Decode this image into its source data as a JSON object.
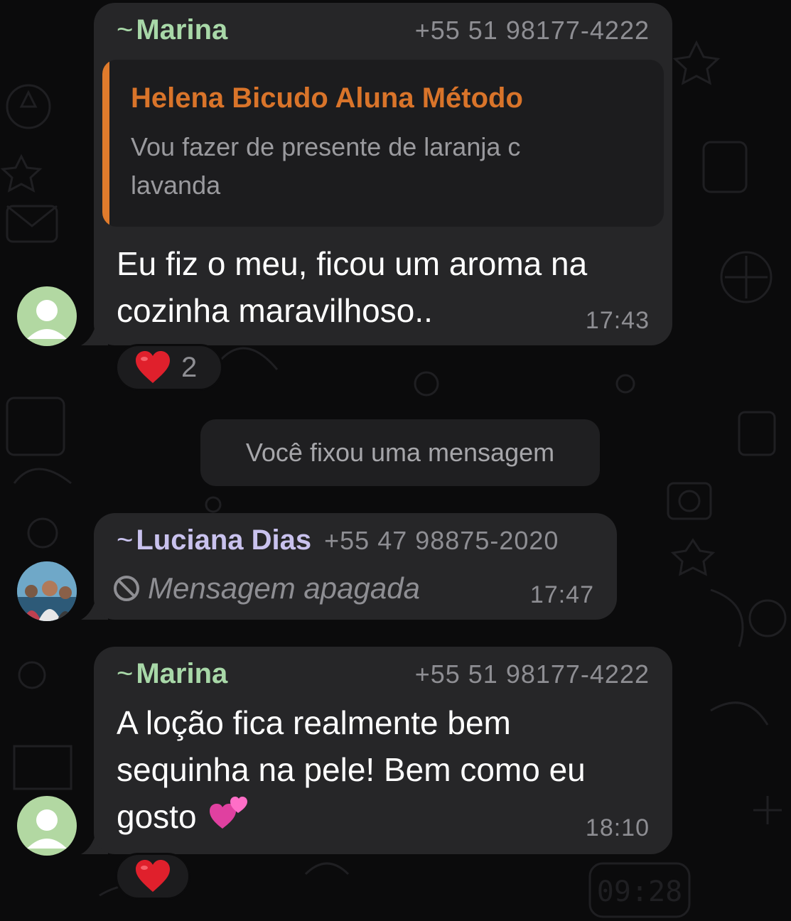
{
  "messages": [
    {
      "sender_prefix": "~",
      "sender": "Marina",
      "sender_color": "#a8d8a8",
      "phone": "+55 51 98177-4222",
      "quoted": {
        "author": "Helena Bicudo Aluna Método",
        "author_color": "#d9742a",
        "text": "Vou fazer de presente de laranja c lavanda"
      },
      "text_lines": [
        "Eu fiz o meu, ficou um aroma na",
        "cozinha maravilhoso.."
      ],
      "time": "17:43",
      "reaction": {
        "emoji": "heart",
        "count": "2"
      }
    },
    {
      "sender_prefix": "~",
      "sender": "Luciana Dias",
      "sender_color": "#c9c2ee",
      "phone": "+55 47 98875-2020",
      "deleted_text": "Mensagem apagada",
      "time": "17:47"
    },
    {
      "sender_prefix": "~",
      "sender": "Marina",
      "sender_color": "#a8d8a8",
      "phone": "+55 51 98177-4222",
      "text_lines": [
        "A loção fica realmente bem",
        "sequinha na pele! Bem como eu",
        "gosto"
      ],
      "emoji": "two-hearts",
      "time": "18:10",
      "reaction": {
        "emoji": "heart"
      }
    }
  ],
  "system_message": "Você fixou uma mensagem",
  "wallpaper_clock": "09:28",
  "colors": {
    "background": "#0b0b0c",
    "bubble": "#262628",
    "quote_bg": "#1c1c1e",
    "quote_bar": "#e07b2c",
    "meta_text": "#8e8e93"
  }
}
